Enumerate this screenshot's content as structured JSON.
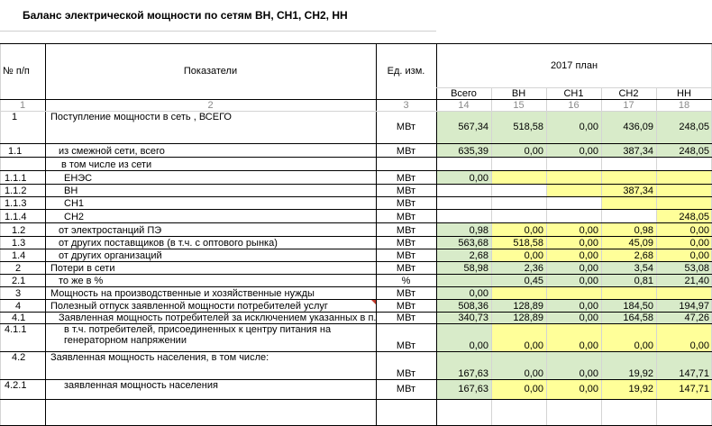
{
  "title": "Баланс электрической мощности по сетям ВН, СН1, СН2, НН",
  "header": {
    "num": "№ п/п",
    "indicators": "Показатели",
    "unit": "Ед. изм.",
    "plan": "2017 план",
    "cols": [
      "Всего",
      "ВН",
      "СН1",
      "СН2",
      "НН"
    ],
    "index_row": [
      "1",
      "2",
      "3",
      "14",
      "15",
      "16",
      "17",
      "18"
    ]
  },
  "colors": {
    "green": "#d8ebc9",
    "yellow": "#ffff99",
    "grid_light": "#d4d4d4",
    "grid_dark": "#000000",
    "marker": "#c0392b"
  },
  "rows": [
    {
      "num": "1",
      "name": "Поступление мощности в сеть , ВСЕГО",
      "unit": "МВт",
      "v": [
        "567,34",
        "518,58",
        "0,00",
        "436,09",
        "248,05"
      ],
      "fill": [
        "g",
        "g",
        "g",
        "g",
        "g"
      ]
    },
    {
      "num": "1.1",
      "name": "из смежной сети, всего",
      "unit": "МВт",
      "v": [
        "635,39",
        "0,00",
        "0,00",
        "387,34",
        "248,05"
      ],
      "fill": [
        "g",
        "g",
        "g",
        "g",
        "g"
      ]
    },
    {
      "num": "",
      "name": "в том числе из сети",
      "unit": "",
      "v": [
        "",
        "",
        "",
        "",
        ""
      ],
      "fill": [
        "",
        "",
        "",
        "",
        ""
      ]
    },
    {
      "num": "1.1.1",
      "name": "ЕНЭС",
      "unit": "МВт",
      "v": [
        "0,00",
        "",
        "",
        "",
        ""
      ],
      "fill": [
        "g",
        "y",
        "y",
        "y",
        "y"
      ]
    },
    {
      "num": "1.1.2",
      "name": "ВН",
      "unit": "МВт",
      "v": [
        "",
        "",
        "",
        "387,34",
        ""
      ],
      "fill": [
        "",
        "",
        "y",
        "y",
        "y"
      ]
    },
    {
      "num": "1.1.3",
      "name": "СН1",
      "unit": "МВт",
      "v": [
        "",
        "",
        "",
        "",
        ""
      ],
      "fill": [
        "",
        "",
        "",
        "y",
        "y"
      ]
    },
    {
      "num": "1.1.4",
      "name": "СН2",
      "unit": "МВт",
      "v": [
        "",
        "",
        "",
        "",
        "248,05"
      ],
      "fill": [
        "",
        "",
        "",
        "",
        "y"
      ]
    },
    {
      "num": "1.2",
      "name": "от электростанций ПЭ",
      "unit": "МВт",
      "v": [
        "0,98",
        "0,00",
        "0,00",
        "0,98",
        "0,00"
      ],
      "fill": [
        "g",
        "y",
        "y",
        "y",
        "y"
      ]
    },
    {
      "num": "1.3",
      "name": "от других поставщиков (в т.ч. с оптового рынка)",
      "unit": "МВт",
      "v": [
        "563,68",
        "518,58",
        "0,00",
        "45,09",
        "0,00"
      ],
      "fill": [
        "g",
        "y",
        "y",
        "y",
        "y"
      ]
    },
    {
      "num": "1.4",
      "name": "от других организаций",
      "unit": "МВт",
      "v": [
        "2,68",
        "0,00",
        "0,00",
        "2,68",
        "0,00"
      ],
      "fill": [
        "g",
        "y",
        "y",
        "y",
        "y"
      ]
    },
    {
      "num": "2",
      "name": "Потери в сети",
      "unit": "МВт",
      "v": [
        "58,98",
        "2,36",
        "0,00",
        "3,54",
        "53,08"
      ],
      "fill": [
        "g",
        "g",
        "g",
        "g",
        "g"
      ]
    },
    {
      "num": "2.1",
      "name": "то же в %",
      "unit": "%",
      "v": [
        "",
        "0,45",
        "0,00",
        "0,81",
        "21,40"
      ],
      "fill": [
        "g",
        "g",
        "g",
        "g",
        "g"
      ]
    },
    {
      "num": "3",
      "name": "Мощность на производственные и хозяйственные нужды",
      "unit": "МВт",
      "v": [
        "0,00",
        "",
        "",
        "",
        ""
      ],
      "fill": [
        "g",
        "y",
        "y",
        "y",
        "y"
      ]
    },
    {
      "num": "4",
      "name": "Полезный отпуск заявленной мощности потребителей услуг",
      "unit": "МВт",
      "v": [
        "508,36",
        "128,89",
        "0,00",
        "184,50",
        "194,97"
      ],
      "fill": [
        "g",
        "g",
        "g",
        "g",
        "g"
      ]
    },
    {
      "num": "4.1",
      "name": "Заявленная мощность потребителей  за исключением указанных в п. 4.2",
      "unit": "МВт",
      "v": [
        "340,73",
        "128,89",
        "0,00",
        "164,58",
        "47,26"
      ],
      "fill": [
        "g",
        "g",
        "g",
        "g",
        "g"
      ]
    },
    {
      "num": "4.1.1",
      "name": "в т.ч. потребителей, присоединенных к центру питания на генераторном напряжении",
      "unit": "МВт",
      "v": [
        "0,00",
        "0,00",
        "0,00",
        "0,00",
        "0,00"
      ],
      "fill": [
        "g",
        "y",
        "y",
        "y",
        "y"
      ]
    },
    {
      "num": "4.2",
      "name": "Заявленная мощность населения, в том числе:",
      "unit": "МВт",
      "v": [
        "167,63",
        "0,00",
        "0,00",
        "19,92",
        "147,71"
      ],
      "fill": [
        "g",
        "g",
        "g",
        "g",
        "g"
      ]
    },
    {
      "num": "4.2.1",
      "name": "заявленная мощность населения",
      "unit": "МВт",
      "v": [
        "167,63",
        "0,00",
        "0,00",
        "19,92",
        "147,71"
      ],
      "fill": [
        "g",
        "y",
        "y",
        "y",
        "y"
      ]
    }
  ]
}
